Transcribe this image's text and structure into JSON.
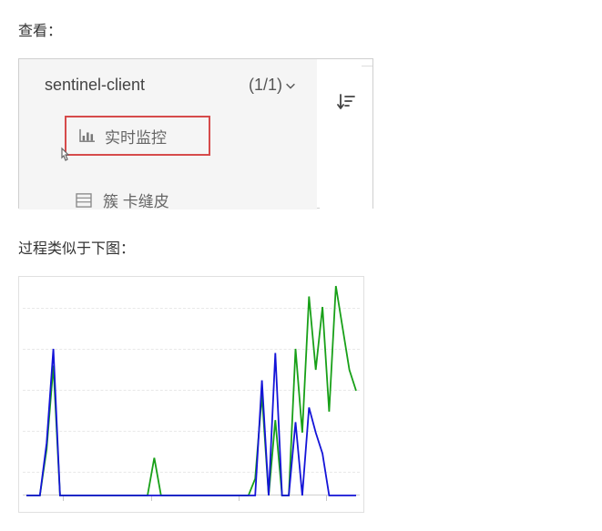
{
  "labels": {
    "view": "查看：",
    "process_similar": "过程类似于下图："
  },
  "sidebar": {
    "app_name": "sentinel-client",
    "count_label": "(1/1)",
    "menu": {
      "realtime": "实时监控",
      "partial_cut": "簇 卡缝皮"
    }
  },
  "chart_data": {
    "type": "line",
    "title": "",
    "xlabel": "",
    "ylabel": "",
    "x": [
      0,
      1,
      2,
      3,
      4,
      5,
      6,
      7,
      8,
      9,
      10,
      11,
      12,
      13,
      14,
      15,
      16,
      17,
      18,
      19,
      20,
      21,
      22,
      23,
      24,
      25,
      26,
      27,
      28,
      29,
      30,
      31,
      32,
      33,
      34,
      35,
      36,
      37,
      38,
      39,
      40,
      41,
      42,
      43,
      44,
      45,
      46,
      47,
      48,
      49
    ],
    "series": [
      {
        "name": "green",
        "color": "#18a018",
        "values": [
          0,
          0,
          0,
          22,
          62,
          0,
          0,
          0,
          0,
          0,
          0,
          0,
          0,
          0,
          0,
          0,
          0,
          0,
          0,
          18,
          0,
          0,
          0,
          0,
          0,
          0,
          0,
          0,
          0,
          0,
          0,
          0,
          0,
          0,
          8,
          48,
          0,
          36,
          0,
          0,
          70,
          30,
          95,
          60,
          90,
          40,
          100,
          80,
          60,
          50
        ]
      },
      {
        "name": "blue",
        "color": "#1414d8",
        "values": [
          0,
          0,
          0,
          25,
          70,
          0,
          0,
          0,
          0,
          0,
          0,
          0,
          0,
          0,
          0,
          0,
          0,
          0,
          0,
          0,
          0,
          0,
          0,
          0,
          0,
          0,
          0,
          0,
          0,
          0,
          0,
          0,
          0,
          0,
          0,
          55,
          0,
          68,
          0,
          0,
          35,
          0,
          42,
          30,
          20,
          0,
          0,
          0,
          0,
          0
        ]
      }
    ],
    "ylim": [
      0,
      100
    ],
    "xlim": [
      0,
      49
    ],
    "grid": true
  }
}
